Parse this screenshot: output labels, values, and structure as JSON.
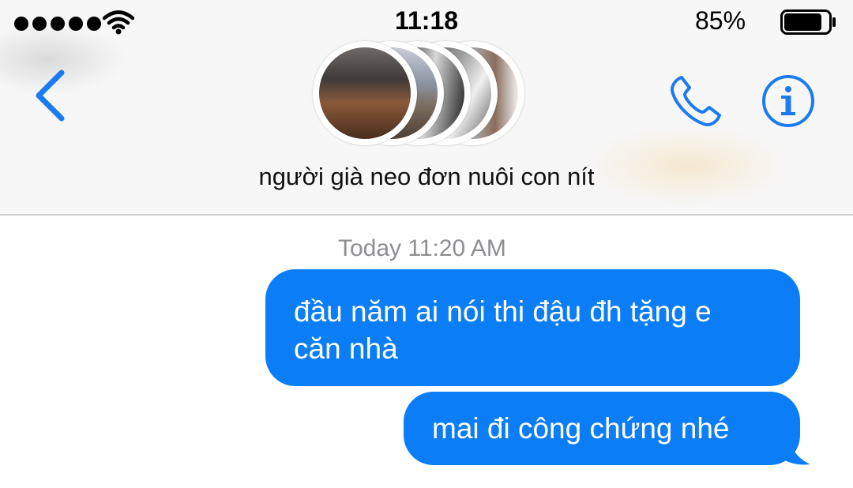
{
  "status_bar": {
    "time": "11:18",
    "battery_percent": "85%",
    "battery_level": 0.85,
    "signal_bars": 5,
    "icons": [
      "signal-dots-icon",
      "wifi-icon",
      "battery-icon"
    ]
  },
  "header": {
    "group_name": "người già neo đơn nuôi con nít",
    "icons": [
      "back-chevron-icon",
      "phone-icon",
      "info-icon"
    ],
    "avatar_count": 5
  },
  "conversation": {
    "timestamp": "Today 11:20 AM",
    "messages": [
      {
        "sender": "me",
        "lines": [
          "đầu năm ai nói thi đậu đh tặng e",
          "căn nhà"
        ]
      },
      {
        "sender": "me",
        "lines": [
          "mai đi công chứng nhé"
        ]
      }
    ]
  },
  "colors": {
    "accent": "#0b7ef7",
    "bubble_text": "#ffffff",
    "header_bg": "#f7f7f7",
    "timestamp": "#8e8e93"
  }
}
